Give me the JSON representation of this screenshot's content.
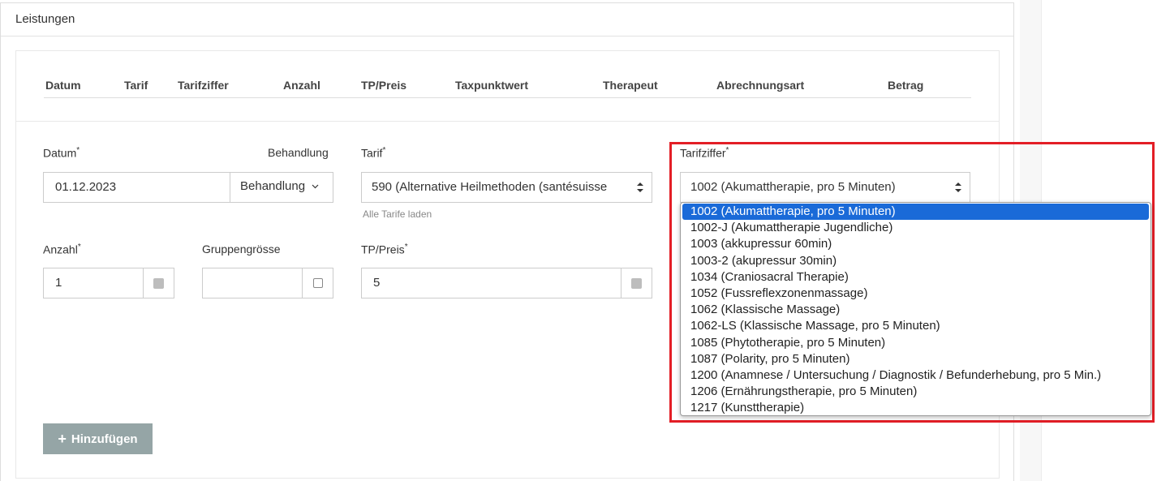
{
  "panel": {
    "title": "Leistungen"
  },
  "table_headers": [
    "Datum",
    "Tarif",
    "Tarifziffer",
    "Anzahl",
    "TP/Preis",
    "Taxpunktwert",
    "Therapeut",
    "Abrechnungsart",
    "Betrag"
  ],
  "form": {
    "datum": {
      "label": "Datum",
      "required": "*",
      "value": "01.12.2023"
    },
    "behandlung": {
      "label": "Behandlung",
      "button_label": "Behandlung"
    },
    "tarif": {
      "label": "Tarif",
      "required": "*",
      "value": "590 (Alternative Heilmethoden (santésuisse",
      "help": "Alle Tarife laden"
    },
    "tarifziffer": {
      "label": "Tarifziffer",
      "required": "*",
      "value": "1002 (Akumattherapie, pro 5 Minuten)"
    },
    "anzahl": {
      "label": "Anzahl",
      "required": "*",
      "value": "1"
    },
    "gruppengroesse": {
      "label": "Gruppengrösse",
      "value": ""
    },
    "tp_preis": {
      "label": "TP/Preis",
      "required": "*",
      "value": "5"
    }
  },
  "add_button": {
    "label": "Hinzufügen"
  },
  "dropdown": {
    "selected_index": 0,
    "options": [
      "1002 (Akumattherapie, pro 5 Minuten)",
      "1002-J (Akumattherapie Jugendliche)",
      "1003 (akkupressur 60min)",
      "1003-2 (akupressur 30min)",
      "1034 (Craniosacral Therapie)",
      "1052 (Fussreflexzonenmassage)",
      "1062 (Klassische Massage)",
      "1062-LS (Klassische Massage, pro 5 Minuten)",
      "1085 (Phytotherapie, pro 5 Minuten)",
      "1087 (Polarity, pro 5 Minuten)",
      "1200 (Anamnese / Untersuchung / Diagnostik / Befunderhebung, pro 5 Min.)",
      "1206 (Ernährungstherapie, pro 5 Minuten)",
      "1217 (Kunsttherapie)"
    ]
  },
  "colors": {
    "highlight": "#e31e26",
    "selected_option": "#1a6ad8",
    "add_button": "#95a5a6"
  }
}
